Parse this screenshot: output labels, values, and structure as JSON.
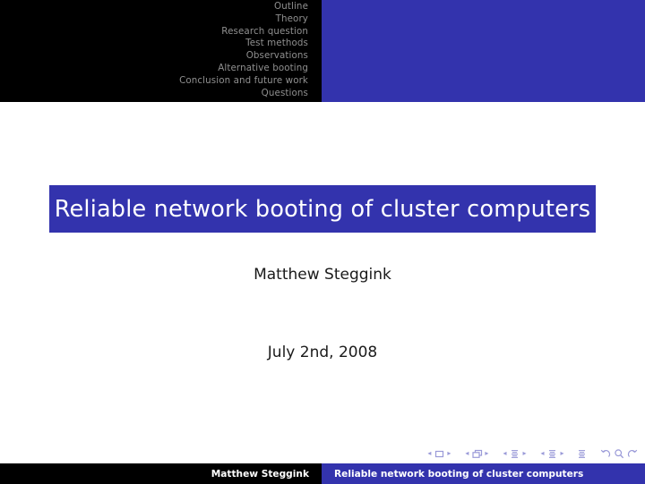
{
  "slide": {
    "title": "Reliable network booting of cluster computers",
    "author": "Matthew Steggink",
    "date": "July 2nd, 2008"
  },
  "navigation": {
    "items": [
      {
        "label": "Outline"
      },
      {
        "label": "Theory"
      },
      {
        "label": "Research question"
      },
      {
        "label": "Test methods"
      },
      {
        "label": "Observations"
      },
      {
        "label": "Alternative booting"
      },
      {
        "label": "Conclusion and future work"
      },
      {
        "label": "Questions"
      }
    ]
  },
  "footer": {
    "left": "Matthew Steggink",
    "right": "Reliable network booting of cluster computers"
  },
  "nav_symbols": {
    "groups": [
      {
        "icon": "slide-icon",
        "prev": "◂",
        "next": "▸"
      },
      {
        "icon": "frame-icon",
        "prev": "◂",
        "next": "▸"
      },
      {
        "icon": "subsection-icon",
        "prev": "◂",
        "next": "▸"
      },
      {
        "icon": "section-icon",
        "prev": "◂",
        "next": "▸"
      }
    ],
    "doc_icon": "document-icon",
    "back_icon": "back-arrow-icon",
    "search_icon": "search-icon",
    "forward_icon": "forward-arrow-icon"
  },
  "colors": {
    "structure_blue": "#3333AD",
    "headline_black": "#000000",
    "nav_text_grey": "#8F8F8F",
    "title_text": "#FFFFFF",
    "body_text": "#1A1A1A",
    "symbol_blue": "#9A9AD8",
    "background": "#FFFFFF"
  }
}
